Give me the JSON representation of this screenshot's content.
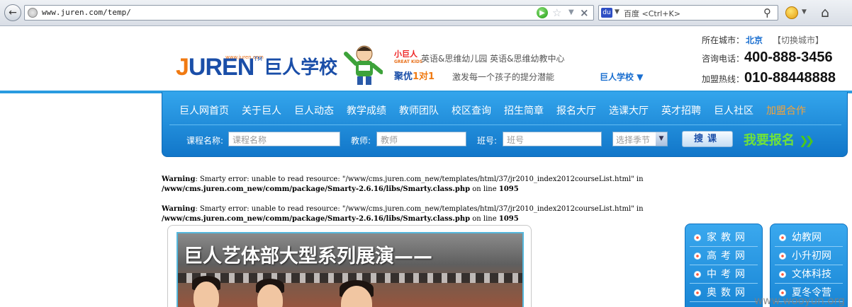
{
  "browser": {
    "url": "www.juren.com/temp/",
    "search_placeholder": "百度 <Ctrl+K>"
  },
  "header": {
    "brand_url": "www.juren.com",
    "brand_en": "JUREN",
    "brand_cn": "巨人学校",
    "sub1_badge": "小巨人",
    "sub1_badge_en": "GREAT KIDS",
    "sub1_text": "英语&思维幼儿园  英语&思维幼教中心",
    "sub2_badge_a": "聚优",
    "sub2_badge_b": "1对1",
    "sub2_text": "激发每一个孩子的提分潜能",
    "switch_school": "巨人学校",
    "city_label": "所在城市：",
    "city_name": "北京",
    "city_change": "【切换城市】",
    "consult_label": "咨询电话：",
    "consult_number": "400-888-3456",
    "franchise_label": "加盟热线：",
    "franchise_number": "010-88448888"
  },
  "nav": {
    "items": [
      "巨人网首页",
      "关于巨人",
      "巨人动态",
      "教学成绩",
      "教师团队",
      "校区查询",
      "招生简章",
      "报名大厅",
      "选课大厅",
      "英才招聘",
      "巨人社区",
      "加盟合作"
    ]
  },
  "course_search": {
    "course_label": "课程名称:",
    "course_placeholder": "课程名称",
    "teacher_label": "教师:",
    "teacher_placeholder": "教师",
    "class_label": "班号:",
    "class_placeholder": "班号",
    "season_placeholder": "选择季节",
    "search_button": "搜课",
    "enroll_button": "我要报名"
  },
  "warnings": [
    {
      "label": "Warning",
      "message": ": Smarty error: unable to read resource: \"/www/cms.juren.com_new/templates/html/37/jr2010_index2012courseList.html\" in ",
      "path": "/www/cms.juren.com_new/comm/package/Smarty-2.6.16/libs/Smarty.class.php",
      "line_text": " on line ",
      "line": "1095"
    },
    {
      "label": "Warning",
      "message": ": Smarty error: unable to read resource: \"/www/cms.juren.com_new/templates/html/37/jr2010_index2012courseList.html\" in ",
      "path": "/www/cms.juren.com_new/comm/package/Smarty-2.6.16/libs/Smarty.class.php",
      "line_text": " on line ",
      "line": "1095"
    }
  ],
  "banner": {
    "title": "巨人艺体部大型系列展演——"
  },
  "side_left": [
    "家教网",
    "高考网",
    "中考网",
    "奥数网"
  ],
  "side_right": [
    "幼教网",
    "小升初网",
    "文体科技",
    "夏冬令营"
  ],
  "watermark": "www.wooyun.org"
}
